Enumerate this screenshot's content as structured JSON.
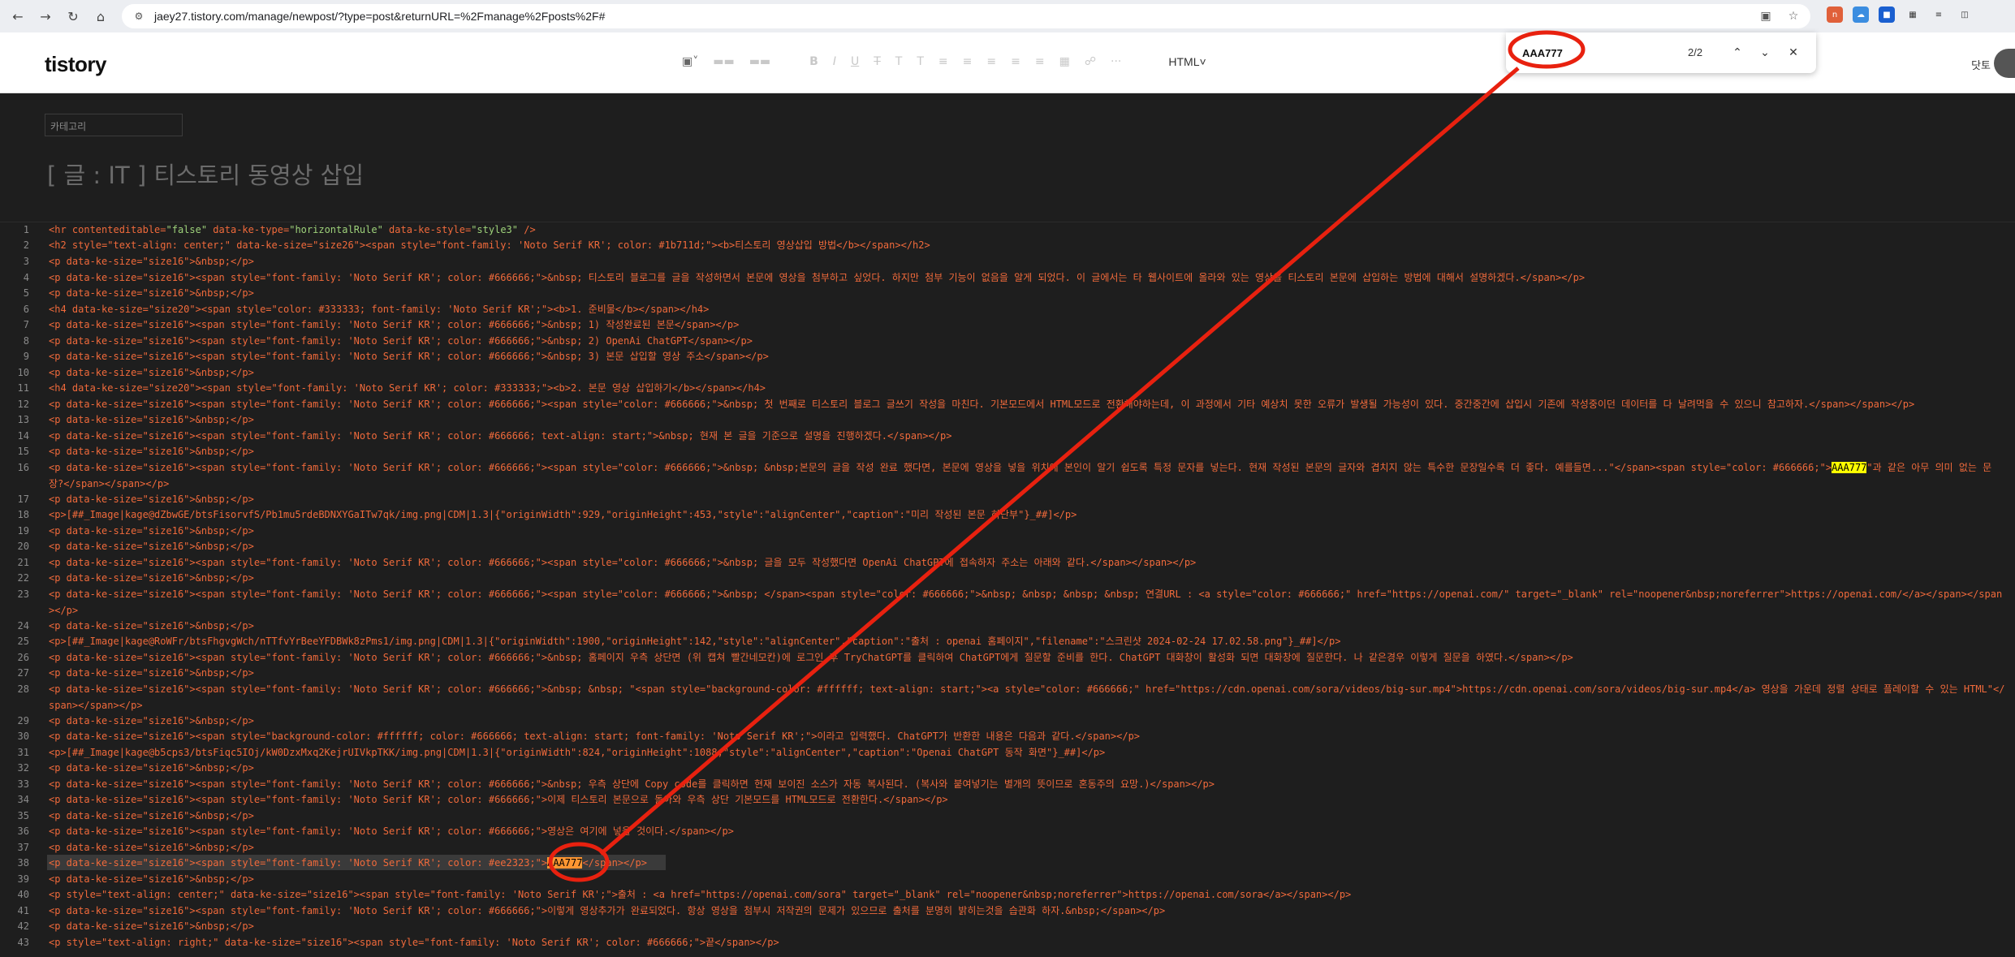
{
  "browser": {
    "url": "jaey27.tistory.com/manage/newpost/?type=post&returnURL=%2Fmanage%2Fposts%2F#"
  },
  "editor": {
    "logo": "tistory",
    "mode_label": "HTML",
    "user_name": "닷토",
    "category_placeholder": "카테고리",
    "post_title": "[ 글 : IT ] 티스토리 동영상 삽입"
  },
  "find": {
    "query": "AAA777",
    "count": "2/2"
  },
  "code": {
    "line_numbers": [
      "1",
      "2",
      "3",
      "4",
      "5",
      "6",
      "7",
      "8",
      "9",
      "10",
      "11",
      "12",
      "13",
      "14",
      "15",
      "16",
      "17",
      "18",
      "19",
      "20",
      "21",
      "22",
      "23",
      "24",
      "25",
      "26",
      "27",
      "28",
      "29",
      "30",
      "31",
      "32",
      "33",
      "34",
      "35",
      "36",
      "37",
      "38",
      "39",
      "40",
      "41",
      "42",
      "43"
    ],
    "lines": {
      "l1a": "<hr contenteditable=",
      "l1b": "\"false\"",
      "l1c": " data-ke-type=",
      "l1d": "\"horizontalRule\"",
      "l1e": " data-ke-style=",
      "l1f": "\"style3\"",
      "l1g": " />",
      "l2": "<h2 style=\"text-align: center;\" data-ke-size=\"size26\"><span style=\"font-family: 'Noto Serif KR'; color: #1b711d;\"><b>티스토리 영상삽입 방법</b></span></h2>",
      "l3": "<p data-ke-size=\"size16\">&nbsp;</p>",
      "l4": "<p data-ke-size=\"size16\"><span style=\"font-family: 'Noto Serif KR'; color: #666666;\">&nbsp; 티스토리 블로그를 글을 작성하면서 본문에 영상을 첨부하고 싶었다. 하지만 첨부 기능이 없음을 알게 되었다. 이 글에서는 타 웹사이트에 올라와 있는 영상을 티스토리 본문에 삽입하는 방법에 대해서 설명하겠다.</span></p>",
      "l5": "<p data-ke-size=\"size16\">&nbsp;</p>",
      "l6": "<h4 data-ke-size=\"size20\"><span style=\"color: #333333; font-family: 'Noto Serif KR';\"><b>1. 준비물</b></span></h4>",
      "l7": "<p data-ke-size=\"size16\"><span style=\"font-family: 'Noto Serif KR'; color: #666666;\">&nbsp; 1) 작성완료된 본문</span></p>",
      "l8": "<p data-ke-size=\"size16\"><span style=\"font-family: 'Noto Serif KR'; color: #666666;\">&nbsp; 2) OpenAi ChatGPT</span></p>",
      "l9": "<p data-ke-size=\"size16\"><span style=\"font-family: 'Noto Serif KR'; color: #666666;\">&nbsp; 3) 본문 삽입할 영상 주소</span></p>",
      "l10": "<p data-ke-size=\"size16\">&nbsp;</p>",
      "l11": "<h4 data-ke-size=\"size20\"><span style=\"font-family: 'Noto Serif KR'; color: #333333;\"><b>2. 본문 영상 삽입하기</b></span></h4>",
      "l12": "<p data-ke-size=\"size16\"><span style=\"font-family: 'Noto Serif KR'; color: #666666;\"><span style=\"color: #666666;\">&nbsp; 첫 번째로 티스토리 블로그 글쓰기 작성을 마친다. 기본모드에서 HTML모드로 전환해야하는데, 이 과정에서 기타 예상치 못한 오류가 발생될 가능성이 있다. 중간중간에 삽입시 기존에 작성중이던 데이터를 다 날려먹을 수 있으니 참고하자.</span></span></p>",
      "l13": "<p data-ke-size=\"size16\">&nbsp;</p>",
      "l14": "<p data-ke-size=\"size16\"><span style=\"font-family: 'Noto Serif KR'; color: #666666; text-align: start;\">&nbsp; 현재 본 글을 기준으로 설명을 진행하겠다.</span></p>",
      "l15": "<p data-ke-size=\"size16\">&nbsp;</p>",
      "l16a": "<p data-ke-size=\"size16\"><span style=\"font-family: 'Noto Serif KR'; color: #666666;\"><span style=\"color: #666666;\">&nbsp; &nbsp;본문의 글을 작성 완료 했다면, 본문에 영상을 넣을 위치에 본인이 알기 쉽도록 특정 문자를 넣는다. 현재 작성된 본문의 글자와 겹치지 않는 특수한 문장일수록 더 좋다. 예를들면...\"</span><span style=\"color: #666666;\">",
      "l16b": "\"과 같은 아무 의미 없는 문장?</span></span></p>",
      "l17": "<p data-ke-size=\"size16\">&nbsp;</p>",
      "l18": "<p>[##_Image|kage@dZbwGE/btsFisorvfS/Pb1mu5rdeBDNXYGaITw7qk/img.png|CDM|1.3|{\"originWidth\":929,\"originHeight\":453,\"style\":\"alignCenter\",\"caption\":\"미리 작성된 본문 하단부\"}_##]</p>",
      "l19": "<p data-ke-size=\"size16\">&nbsp;</p>",
      "l20": "<p data-ke-size=\"size16\">&nbsp;</p>",
      "l21": "<p data-ke-size=\"size16\"><span style=\"font-family: 'Noto Serif KR'; color: #666666;\"><span style=\"color: #666666;\">&nbsp; 글을 모두 작성했다면 OpenAi ChatGPT에 접속하자 주소는 아래와 같다.</span></span></p>",
      "l22": "<p data-ke-size=\"size16\">&nbsp;</p>",
      "l23": "<p data-ke-size=\"size16\"><span style=\"font-family: 'Noto Serif KR'; color: #666666;\"><span style=\"color: #666666;\">&nbsp; </span><span style=\"color: #666666;\">&nbsp; &nbsp; &nbsp; &nbsp; 연결URL : <a style=\"color: #666666;\" href=\"https://openai.com/\" target=\"_blank\" rel=\"noopener&nbsp;noreferrer\">https://openai.com/</a></span></span></p>",
      "l24": "<p data-ke-size=\"size16\">&nbsp;</p>",
      "l25": "<p>[##_Image|kage@RoWFr/btsFhgvgWch/nTTfvYrBeeYFDBWk8zPms1/img.png|CDM|1.3|{\"originWidth\":1900,\"originHeight\":142,\"style\":\"alignCenter\",\"caption\":\"출처 : openai 홈페이지\",\"filename\":\"스크린샷 2024-02-24 17.02.58.png\"}_##]</p>",
      "l26": "<p data-ke-size=\"size16\"><span style=\"font-family: 'Noto Serif KR'; color: #666666;\">&nbsp; 홈페이지 우측 상단면 (위 캡쳐 빨간네모칸)에 로그인 후 TryChatGPT를 클릭하여 ChatGPT에게 질문할 준비를 한다. ChatGPT 대화창이 활성화 되면 대화창에 질문한다. 나 같은경우 이렇게 질문을 하였다.</span></p>",
      "l27": "<p data-ke-size=\"size16\">&nbsp;</p>",
      "l28": "<p data-ke-size=\"size16\"><span style=\"font-family: 'Noto Serif KR'; color: #666666;\">&nbsp; &nbsp; \"<span style=\"background-color: #ffffff; text-align: start;\"><a style=\"color: #666666;\" href=\"https://cdn.openai.com/sora/videos/big-sur.mp4\">https://cdn.openai.com/sora/videos/big-sur.mp4</a> 영상을 가운데 정렬 상태로 플레이할 수 있는 HTML\"</span></span></p>",
      "l29": "<p data-ke-size=\"size16\">&nbsp;</p>",
      "l30": "<p data-ke-size=\"size16\"><span style=\"background-color: #ffffff; color: #666666; text-align: start; font-family: 'Noto Serif KR';\">이라고 입력했다. ChatGPT가 반환한 내용은 다음과 같다.</span></p>",
      "l31": "<p>[##_Image|kage@b5cps3/btsFiqc5IOj/kW0DzxMxq2KejrUIVkpTKK/img.png|CDM|1.3|{\"originWidth\":824,\"originHeight\":1088,\"style\":\"alignCenter\",\"caption\":\"Openai ChatGPT 동작 화면\"}_##]</p>",
      "l32": "<p data-ke-size=\"size16\">&nbsp;</p>",
      "l33": "<p data-ke-size=\"size16\"><span style=\"font-family: 'Noto Serif KR'; color: #666666;\">&nbsp; 우측 상단에 Copy code를 클릭하면 현재 보이진 소스가 자동 복사된다. (복사와 붙여넣기는 별개의 뜻이므로 혼동주의 요망.)</span></p>",
      "l34": "<p data-ke-size=\"size16\"><span style=\"font-family: 'Noto Serif KR'; color: #666666;\">이제 티스토리 본문으로 돌아와 우측 상단 기본모드를 HTML모드로 전환한다.</span></p>",
      "l35": "<p data-ke-size=\"size16\">&nbsp;</p>",
      "l36": "<p data-ke-size=\"size16\"><span style=\"font-family: 'Noto Serif KR'; color: #666666;\">영상은 여기에 넣을 것이다.</span></p>",
      "l37": "<p data-ke-size=\"size16\">&nbsp;</p>",
      "l38a": "<p data-ke-size=\"size16\"><span style=\"font-family: 'Noto Serif KR'; color: #ee2323;\">",
      "l38b": "</span></p>",
      "l39": "<p data-ke-size=\"size16\">&nbsp;</p>",
      "l40": "<p style=\"text-align: center;\" data-ke-size=\"size16\"><span style=\"font-family: 'Noto Serif KR';\">출처 : <a href=\"https://openai.com/sora\" target=\"_blank\" rel=\"noopener&nbsp;noreferrer\">https://openai.com/sora</a></span></p>",
      "l41": "<p data-ke-size=\"size16\"><span style=\"font-family: 'Noto Serif KR'; color: #666666;\">이렇게 영상추가가 완료되었다. 항상 영상을 첨부시 저작권의 문제가 있으므로 출처를 분명히 밝히는것을 습관화 하자.&nbsp;</span></p>",
      "l42": "<p data-ke-size=\"size16\">&nbsp;</p>",
      "l43": "<p style=\"text-align: right;\" data-ke-size=\"size16\"><span style=\"font-family: 'Noto Serif KR'; color: #666666;\">끝</span></p>"
    },
    "match": "AAA777"
  },
  "colors": {
    "annotation": "#e8210f",
    "match_highlight": "#ffff00",
    "current_match": "#ff9632"
  }
}
